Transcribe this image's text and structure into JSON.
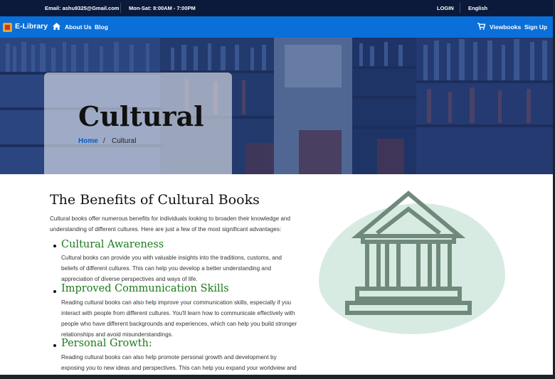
{
  "topbar": {
    "email": "Email: ashu9325@Gmail.com",
    "hours": "Mon-Sat: 8:00AM - 7:00PM",
    "login": "LOGIN",
    "language": "English"
  },
  "navbar": {
    "brand": "E-Library",
    "links": [
      "About Us",
      "Blog"
    ],
    "viewbooks": "Viewbooks",
    "signup": "Sign Up",
    "home_icon": "home-icon",
    "cart_icon": "cart-icon"
  },
  "hero": {
    "title": "Cultural",
    "breadcrumb": {
      "home": "Home",
      "separator": "/",
      "current": "Cultural"
    }
  },
  "article": {
    "title": "The Benefits of Cultural Books",
    "intro": [
      "Cultural books offer numerous benefits for individuals looking to broaden their knowledge and",
      "understanding of different cultures. Here are just a few of the most significant advantages:"
    ],
    "sections": [
      {
        "heading": "Cultural Awareness",
        "lines": [
          "Cultural books can provide you with valuable insights into the traditions, customs, and",
          "beliefs of different cultures. This can help you develop a better understanding and",
          "appreciation of diverse perspectives and ways of life."
        ]
      },
      {
        "heading": "Improved Communication Skills",
        "lines": [
          "Reading cultural books can also help improve your communication skills, especially if you",
          "interact with people from different cultures. You'll learn how to communicate effectively with",
          "people who have different backgrounds and experiences, which can help you build stronger",
          "relationships and avoid misunderstandings."
        ]
      },
      {
        "heading": "Personal Growth:",
        "lines": [
          "Reading cultural books can also help promote personal growth and development by",
          "exposing you to new ideas and perspectives. This can help you expand your worldview and"
        ]
      }
    ]
  },
  "illustration": {
    "icon": "bank-columns-icon",
    "fill": "#d8ebe2",
    "stroke": "#6f8a7b"
  },
  "colors": {
    "topbar": "#0b1a3a",
    "navbar": "#0a6fd8",
    "heading_green": "#1a7a1a",
    "link_blue": "#0a5bbf"
  }
}
